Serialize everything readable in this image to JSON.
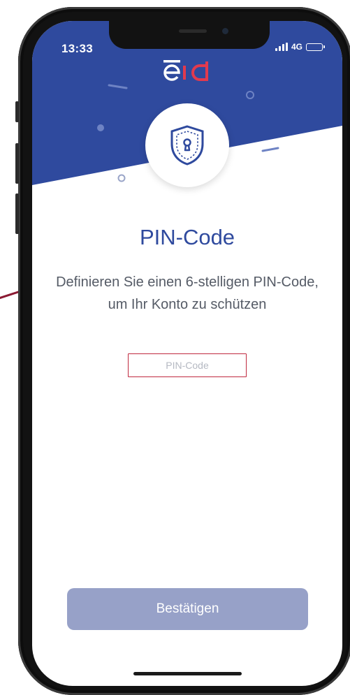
{
  "status_bar": {
    "time": "13:33",
    "network": "4G",
    "battery_level": 0.65
  },
  "header": {
    "logo_text": "eid",
    "brand_color": "#2f4a9e",
    "logo_accent_color": "#e23a4e"
  },
  "icons": {
    "shield": "shield-keyhole-icon"
  },
  "content": {
    "title": "PIN-Code",
    "description": "Definieren Sie einen 6-stelligen PIN-Code, um Ihr Konto zu schützen"
  },
  "pin_field": {
    "value": "",
    "placeholder": "PIN-Code",
    "border_color": "#c0293f"
  },
  "actions": {
    "confirm_label": "Bestätigen",
    "confirm_color": "#97a1c8"
  }
}
